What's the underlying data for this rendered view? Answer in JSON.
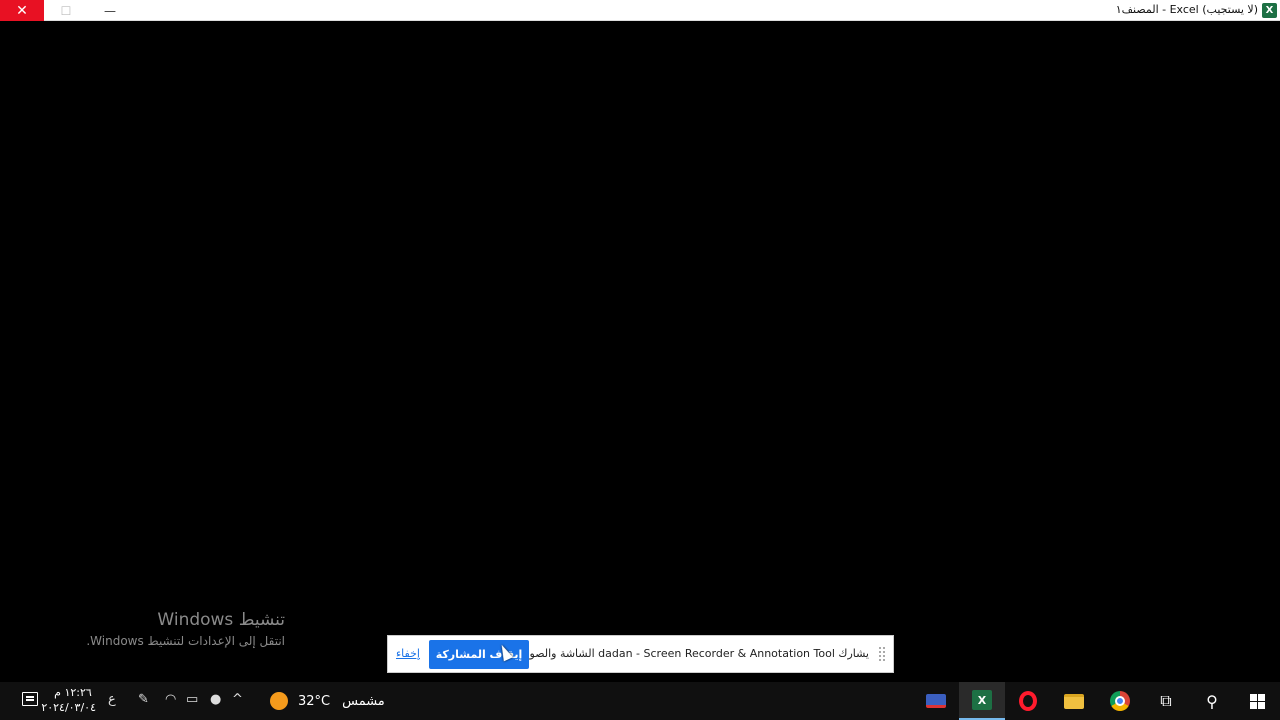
{
  "window": {
    "title": "(لا يستجيب) Excel - المصنف١",
    "app_icon": "excel-icon",
    "close_glyph": "✕",
    "maximize_glyph": "☐",
    "minimize_glyph": "—"
  },
  "watermark": {
    "line1": "تنشيط Windows",
    "line2": "انتقل إلى الإعدادات لتنشيط Windows."
  },
  "share_bar": {
    "message": "يشارك dadan - Screen Recorder & Annotation Tool الشاشة والصوت.",
    "stop_label": "إيقاف المشاركة",
    "hide_label": "إخفاء"
  },
  "taskbar": {
    "start_icon": "windows-start-icon",
    "search_icon": "search-icon",
    "task_view_icon": "task-view-icon",
    "apps": [
      "chrome-icon",
      "file-explorer-icon",
      "opera-icon",
      "excel-icon",
      "screen-recorder-icon"
    ],
    "active_app": "excel-icon",
    "weather": {
      "temp": "32°C",
      "condition": "مشمس"
    },
    "language": "ع",
    "clock": {
      "time": "١٢:٢٦ م",
      "date": "٢٠٢٤/٠٣/٠٤"
    },
    "accent": "#76b9ed"
  },
  "colors": {
    "close_red": "#e81123",
    "share_blue": "#1a73e8",
    "excel_green": "#1d7044"
  }
}
